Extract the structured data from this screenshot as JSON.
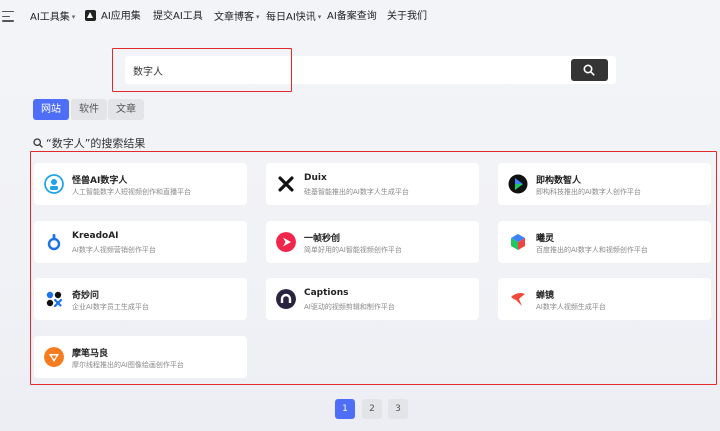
{
  "nav": {
    "items": [
      {
        "label": "AI工具集",
        "caret": true
      },
      {
        "label": "AI应用集",
        "icon": "ai-app-icon"
      },
      {
        "label": "提交AI工具"
      },
      {
        "label": "文章博客",
        "caret": true
      },
      {
        "label": "每日AI快讯",
        "caret": true
      },
      {
        "label": "AI备案查询"
      },
      {
        "label": "关于我们"
      }
    ]
  },
  "search": {
    "value": "数字人",
    "button_icon": "search-icon"
  },
  "tabs": [
    {
      "label": "网站",
      "active": true
    },
    {
      "label": "软件",
      "active": false
    },
    {
      "label": "文章",
      "active": false
    }
  ],
  "results": {
    "title": "“数字人”的搜索结果"
  },
  "cards": [
    {
      "name": "怪兽AI数字人",
      "desc": "人工智能数字人短视频创作和直播平台",
      "icon": "monster-logo"
    },
    {
      "name": "Duix",
      "desc": "硅基智能推出的AI数字人生成平台",
      "icon": "duix-logo"
    },
    {
      "name": "即构数智人",
      "desc": "即构科技推出的AI数字人创作平台",
      "icon": "zego-logo"
    },
    {
      "name": "KreadoAI",
      "desc": "AI数字人视频营销创作平台",
      "icon": "kreado-logo"
    },
    {
      "name": "一帧秒创",
      "desc": "简单好用的AI智能视频创作平台",
      "icon": "yizhen-logo"
    },
    {
      "name": "曦灵",
      "desc": "百度推出的AI数字人和视频创作平台",
      "icon": "xiling-logo"
    },
    {
      "name": "奇妙问",
      "desc": "企业AI数字员工生成平台",
      "icon": "qimiaowen-logo"
    },
    {
      "name": "Captions",
      "desc": "AI驱动的视频剪辑和制作平台",
      "icon": "captions-logo"
    },
    {
      "name": "蝉镜",
      "desc": "AI数字人视频生成平台",
      "icon": "chanjing-logo"
    },
    {
      "name": "摩笔马良",
      "desc": "摩尔线程推出的AI图像绘画创作平台",
      "icon": "mobi-logo"
    }
  ],
  "pagination": [
    {
      "label": "1",
      "active": true
    },
    {
      "label": "2",
      "active": false
    },
    {
      "label": "3",
      "active": false
    }
  ],
  "colors": {
    "accent": "#4f6ef7",
    "highlight": "#e32a2a",
    "search_button": "#343434"
  }
}
